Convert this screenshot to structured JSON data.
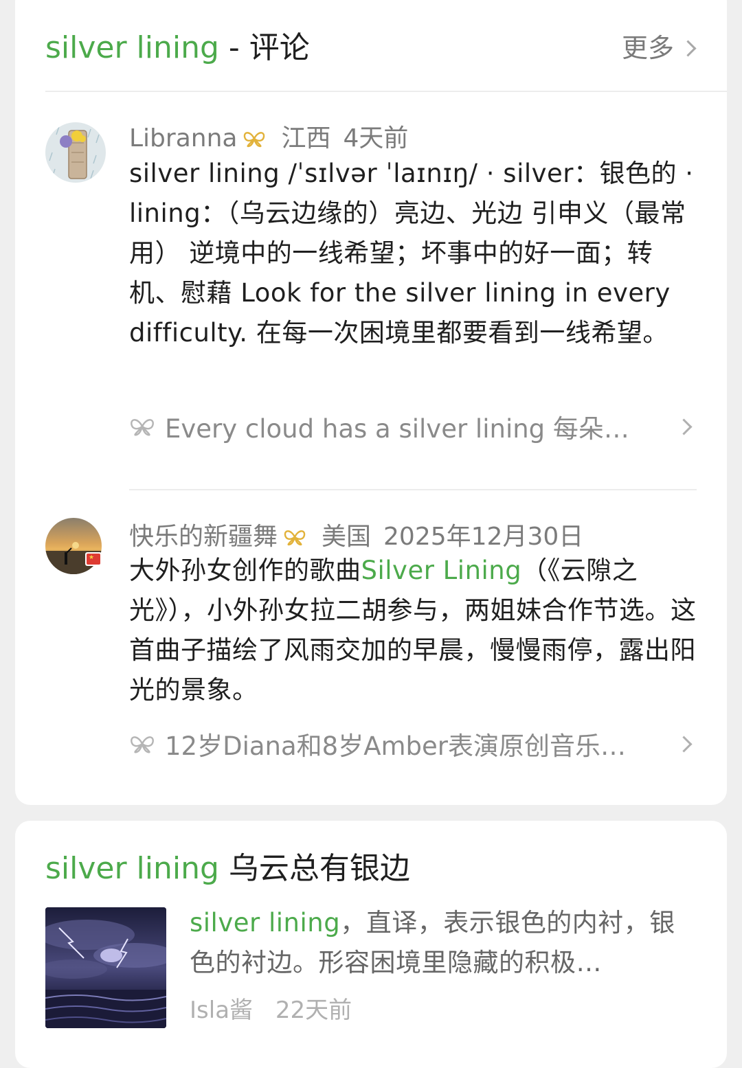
{
  "comments_card": {
    "title_keyword": "silver lining",
    "title_separator": " - ",
    "title_suffix": "评论",
    "more_label": "更多",
    "comments": [
      {
        "author": "Libranna",
        "location": "江西",
        "time": "4天前",
        "text": "silver lining /ˈsɪlvər ˈlaɪnɪŋ/ · silver：银色的 · lining：（乌云边缘的）亮边、光边 引申义（最常用） 逆境中的一线希望；坏事中的好一面；转机、慰藉 Look for the silver lining in every difficulty. 在每一次困境里都要看到一线希望。",
        "quote": "Every cloud has a silver lining 每朵…"
      },
      {
        "author": "快乐的新疆舞",
        "location": "美国",
        "time": "2025年12月30日",
        "text_before": "大外孙女创作的歌曲",
        "text_highlight": "Silver Lining",
        "text_after": "（《云隙之光》），小外孙女拉二胡参与，两姐妹合作节选。这首曲子描绘了风雨交加的早晨，慢慢雨停，露出阳光的景象。",
        "quote": "12岁Diana和8岁Amber表演原创音乐…"
      }
    ]
  },
  "article_card": {
    "title_keyword": "silver lining",
    "title_suffix": " 乌云总有银边",
    "desc_highlight": "silver lining",
    "desc_rest": "，直译，表示银色的内衬，银色的衬边。形容困境里隐藏的积极…",
    "author": "Isla酱",
    "time": "22天前"
  },
  "colors": {
    "accent_green": "#4caa4b",
    "badge_gold": "#e2b23a",
    "text_primary": "#1f1f1f",
    "text_secondary": "#7b7b7b"
  }
}
